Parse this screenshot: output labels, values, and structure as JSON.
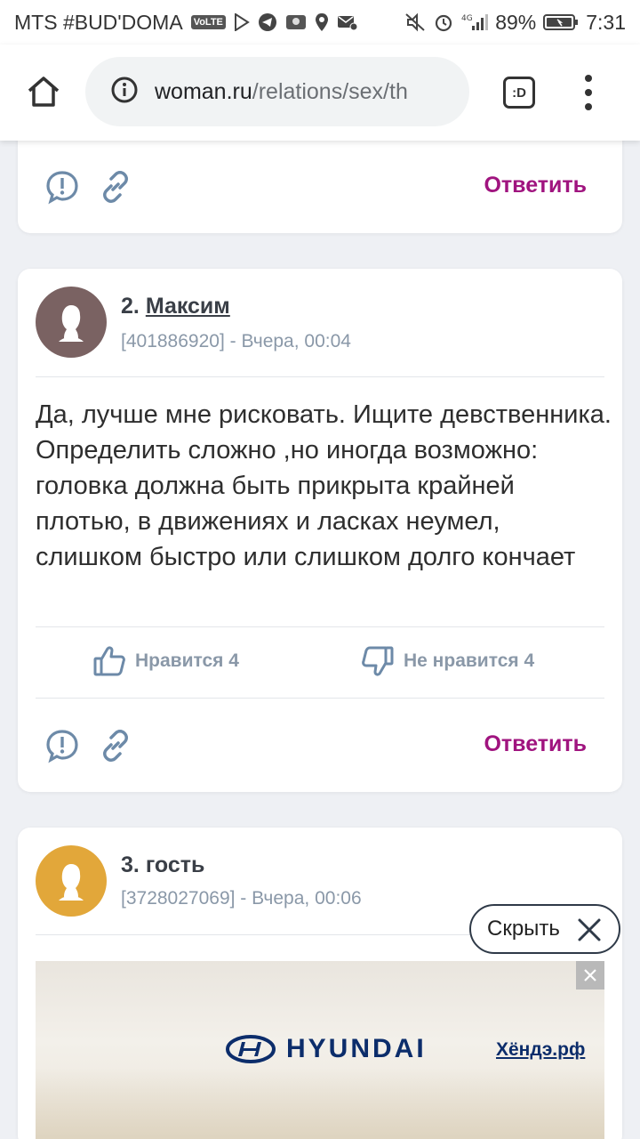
{
  "status_bar": {
    "carrier": "MTS #BUD'DOMA",
    "volte": "VoLTE",
    "network": "4G",
    "battery": "89%",
    "time": "7:31"
  },
  "browser": {
    "url_host": "woman.ru",
    "url_path": "/relations/sex/th",
    "tabs_label": ":D"
  },
  "card1": {
    "reply_label": "Ответить"
  },
  "post2": {
    "number": "2.",
    "author": "Максим",
    "meta": "[401886920] - Вчера, 00:04",
    "text": "Да, лучше мне рисковать. Ищите девственника. Определить сложно ,но иногда возможно: головка должна быть прикрыта крайней плотью, в движениях и ласках неумел, слишком быстро или слишком долго кончает",
    "like_label": "Нравится 4",
    "dislike_label": "Не нравится 4",
    "reply_label": "Ответить",
    "avatar_color": "#7a6262"
  },
  "post3": {
    "number": "3.",
    "author": "гость",
    "meta": "[3728027069] - Вчера, 00:06",
    "avatar_color": "#e2a73a"
  },
  "hide_button": {
    "label": "Скрыть"
  },
  "ad": {
    "brand": "HYUNDAI",
    "link": "Хёндэ.рф"
  },
  "colors": {
    "accent": "#a0147f",
    "muted": "#8a98a8",
    "icon": "#6d8aa8"
  }
}
